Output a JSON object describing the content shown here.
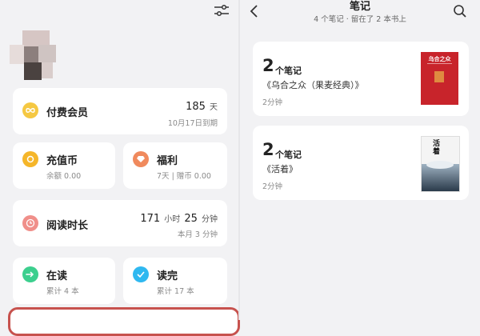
{
  "left": {
    "membership": {
      "title": "付费会员",
      "days_value": "185",
      "days_unit": "天",
      "expiry": "10月17日到期"
    },
    "recharge": {
      "title": "充值币",
      "balance": "余额 0.00"
    },
    "welfare": {
      "title": "福利",
      "detail": "7天 | 赠币 0.00"
    },
    "reading_time": {
      "title": "阅读时长",
      "hours": "171",
      "hours_unit": "小时",
      "minutes": "25",
      "minutes_unit": "分钟",
      "this_month": "本月 3 分钟"
    },
    "reading": {
      "title": "在读",
      "total": "累计 4 本"
    },
    "finished": {
      "title": "读完",
      "total": "累计 17 本"
    }
  },
  "right": {
    "header": {
      "title": "笔记",
      "subtitle": "4 个笔记 · 留在了 2 本书上"
    },
    "notes": [
      {
        "count": "2",
        "unit": "个笔记",
        "book": "《乌合之众（果麦经典）》",
        "duration": "2分钟",
        "cover_title": "乌合之众"
      },
      {
        "count": "2",
        "unit": "个笔记",
        "book": "《活着》",
        "duration": "2分钟",
        "cover_title": "活着"
      }
    ]
  },
  "colors": {
    "membership_icon": "#f5c842",
    "recharge_icon": "#f5b62a",
    "welfare_icon": "#f08a5d",
    "reading_time_icon": "#f08f8a",
    "reading_icon": "#3ccf8e",
    "finished_icon": "#2fb8f0",
    "highlight_border": "#c7524e",
    "cover_red": "#c8242b"
  },
  "icons": [
    "filter-icon",
    "back-arrow-icon",
    "search-icon",
    "infinity-icon",
    "coin-icon",
    "diamond-icon",
    "clock-icon",
    "arrow-right-icon",
    "checkmark-icon"
  ]
}
